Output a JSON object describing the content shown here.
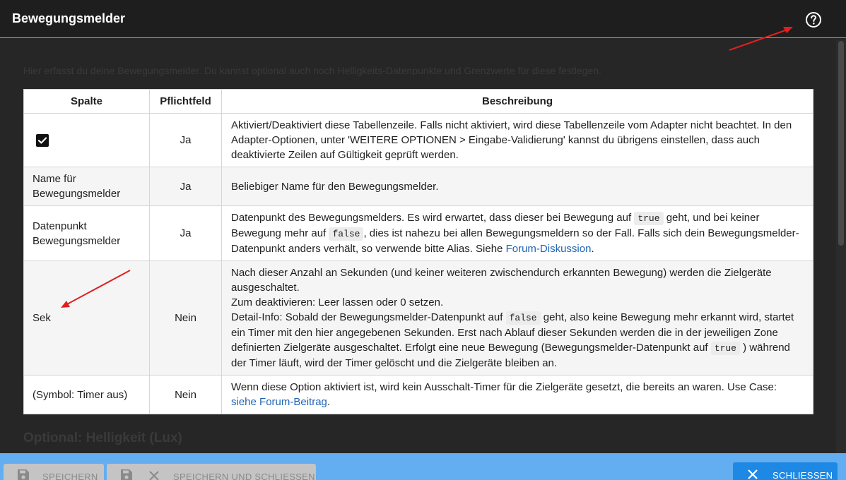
{
  "dialog": {
    "title": "Bewegungsmelder",
    "intro": "Hier erfasst du deine Bewegungsmelder. Du kannst optional auch noch Helligkeits-Datenpunkte und Grenzwerte für diese festlegen.",
    "next_section": "Optional: Helligkeit (Lux)"
  },
  "table": {
    "headers": [
      "Spalte",
      "Pflichtfeld",
      "Beschreibung"
    ],
    "rows": [
      {
        "column": "",
        "required": "Ja",
        "desc": "Aktiviert/Deaktiviert diese Tabellenzeile. Falls nicht aktiviert, wird diese Tabellenzeile vom Adapter nicht beachtet. In den Adapter-Optionen, unter 'WEITERE OPTIONEN > Eingabe-Validierung' kannst du übrigens einstellen, dass auch deaktivierte Zeilen auf Gültigkeit geprüft werden."
      },
      {
        "column": "Name für Bewegungsmelder",
        "required": "Ja",
        "desc": "Beliebiger Name für den Bewegungsmelder."
      },
      {
        "column": "Datenpunkt Bewegungsmelder",
        "required": "Ja",
        "desc_a": "Datenpunkt des Bewegungsmelders. Es wird erwartet, dass dieser bei Bewegung auf",
        "code_a": "true",
        "desc_b": "geht, und bei keiner Bewegung mehr auf",
        "code_b": "false",
        "desc_c": ", dies ist nahezu bei allen Bewegungsmeldern so der Fall. Falls sich dein Bewegungsmelder-Datenpunkt anders verhält, so verwende bitte Alias. Siehe",
        "link": "Forum-Diskussion",
        "desc_d": "."
      },
      {
        "column": "Sek",
        "required": "Nein",
        "line1": "Nach dieser Anzahl an Sekunden (und keiner weiteren zwischendurch erkannten Bewegung) werden die Zielgeräte ausgeschaltet.",
        "line2": "Zum deaktivieren: Leer lassen oder 0 setzen.",
        "desc_a": "Detail-Info: Sobald der Bewegungsmelder-Datenpunkt auf",
        "code_a": "false",
        "desc_b": "geht, also keine Bewegung mehr erkannt wird, startet ein Timer mit den hier angegebenen Sekunden. Erst nach Ablauf dieser Sekunden werden die in der jeweiligen Zone definierten Zielgeräte ausgeschaltet. Erfolgt eine neue Bewegung (Bewegungsmelder-Datenpunkt auf",
        "code_b": "true",
        "desc_c": ") während der Timer läuft, wird der Timer gelöscht und die Zielgeräte bleiben an."
      },
      {
        "column": "(Symbol: Timer aus)",
        "required": "Nein",
        "desc_a": "Wenn diese Option aktiviert ist, wird kein Ausschalt-Timer für die Zielgeräte gesetzt, die bereits an waren. Use Case:",
        "link": "siehe Forum-Beitrag",
        "desc_b": "."
      }
    ]
  },
  "footer": {
    "save": "SPEICHERN",
    "save_close": "SPEICHERN UND SCHLIESSEN",
    "close": "SCHLIESSEN"
  },
  "colors": {
    "title_bar": "#1e1e1e",
    "footer_bar": "#63aef0",
    "close_button": "#1e88e5",
    "annotation_arrow": "#e02020"
  },
  "icons": [
    "help-circle-icon",
    "checkbox-checked-icon",
    "save-icon",
    "close-x-icon"
  ]
}
